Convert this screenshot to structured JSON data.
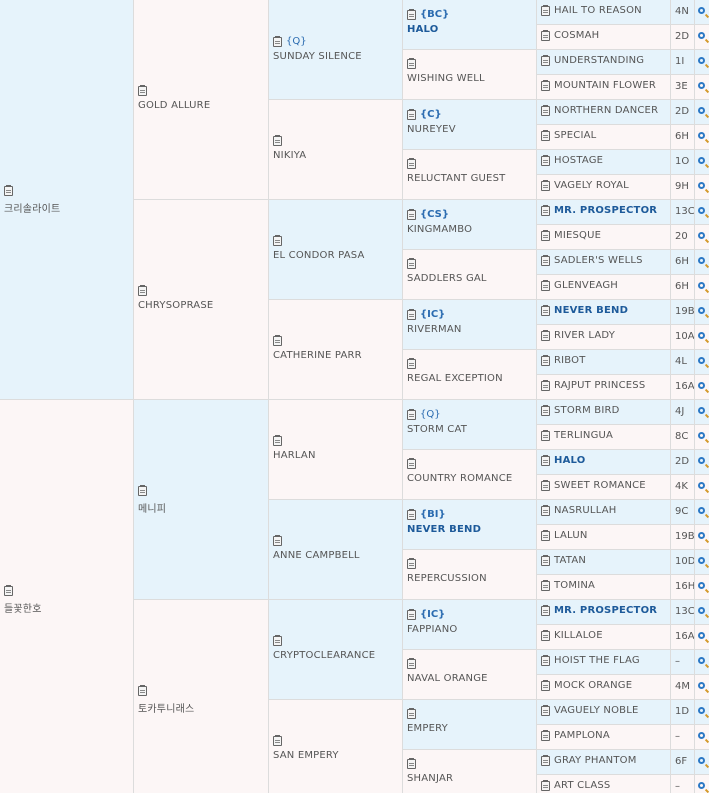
{
  "pedigree": {
    "gen1": [
      {
        "name": "크리솔라이트",
        "tag": ""
      },
      {
        "name": "들꽃한호",
        "tag": ""
      }
    ],
    "gen2": [
      {
        "name": "GOLD ALLURE",
        "tag": ""
      },
      {
        "name": "CHRYSOPRASE",
        "tag": ""
      },
      {
        "name": "메니피",
        "tag": ""
      },
      {
        "name": "토카투니래스",
        "tag": ""
      }
    ],
    "gen3": [
      {
        "name": "SUNDAY SILENCE",
        "tag": "{Q}"
      },
      {
        "name": "NIKIYA",
        "tag": ""
      },
      {
        "name": "EL CONDOR PASA",
        "tag": ""
      },
      {
        "name": "CATHERINE PARR",
        "tag": ""
      },
      {
        "name": "HARLAN",
        "tag": ""
      },
      {
        "name": "ANNE CAMPBELL",
        "tag": ""
      },
      {
        "name": "CRYPTOCLEARANCE",
        "tag": ""
      },
      {
        "name": "SAN EMPERY",
        "tag": ""
      }
    ],
    "gen4": [
      {
        "name": "HALO",
        "tag": "{BC}"
      },
      {
        "name": "WISHING WELL",
        "tag": ""
      },
      {
        "name": "NUREYEV",
        "tag": "{C}"
      },
      {
        "name": "RELUCTANT GUEST",
        "tag": ""
      },
      {
        "name": "KINGMAMBO",
        "tag": "{CS}"
      },
      {
        "name": "SADDLERS GAL",
        "tag": ""
      },
      {
        "name": "RIVERMAN",
        "tag": "{IC}"
      },
      {
        "name": "REGAL EXCEPTION",
        "tag": ""
      },
      {
        "name": "STORM CAT",
        "tag": "{Q}"
      },
      {
        "name": "COUNTRY ROMANCE",
        "tag": ""
      },
      {
        "name": "NEVER BEND",
        "tag": "{BI}"
      },
      {
        "name": "REPERCUSSION",
        "tag": ""
      },
      {
        "name": "FAPPIANO",
        "tag": "{IC}"
      },
      {
        "name": "NAVAL ORANGE",
        "tag": ""
      },
      {
        "name": "EMPERY",
        "tag": ""
      },
      {
        "name": "SHANJAR",
        "tag": ""
      }
    ],
    "gen5": [
      {
        "name": "HAIL TO REASON",
        "code": "4N"
      },
      {
        "name": "COSMAH",
        "code": "2D"
      },
      {
        "name": "UNDERSTANDING",
        "code": "1I"
      },
      {
        "name": "MOUNTAIN FLOWER",
        "code": "3E"
      },
      {
        "name": "NORTHERN DANCER",
        "code": "2D"
      },
      {
        "name": "SPECIAL",
        "code": "6H"
      },
      {
        "name": "HOSTAGE",
        "code": "1O"
      },
      {
        "name": "VAGELY ROYAL",
        "code": "9H"
      },
      {
        "name": "MR. PROSPECTOR",
        "code": "13C"
      },
      {
        "name": "MIESQUE",
        "code": "20"
      },
      {
        "name": "SADLER'S WELLS",
        "code": "6H"
      },
      {
        "name": "GLENVEAGH",
        "code": "6H"
      },
      {
        "name": "NEVER BEND",
        "code": "19B"
      },
      {
        "name": "RIVER LADY",
        "code": "10A"
      },
      {
        "name": "RIBOT",
        "code": "4L"
      },
      {
        "name": "RAJPUT PRINCESS",
        "code": "16A"
      },
      {
        "name": "STORM BIRD",
        "code": "4J"
      },
      {
        "name": "TERLINGUA",
        "code": "8C"
      },
      {
        "name": "HALO",
        "code": "2D"
      },
      {
        "name": "SWEET ROMANCE",
        "code": "4K"
      },
      {
        "name": "NASRULLAH",
        "code": "9C"
      },
      {
        "name": "LALUN",
        "code": "19B"
      },
      {
        "name": "TATAN",
        "code": "10D"
      },
      {
        "name": "TOMINA",
        "code": "16H"
      },
      {
        "name": "MR. PROSPECTOR",
        "code": "13C"
      },
      {
        "name": "KILLALOE",
        "code": "16A"
      },
      {
        "name": "HOIST THE FLAG",
        "code": "–"
      },
      {
        "name": "MOCK ORANGE",
        "code": "4M"
      },
      {
        "name": "VAGUELY NOBLE",
        "code": "1D"
      },
      {
        "name": "PAMPLONA",
        "code": "–"
      },
      {
        "name": "GRAY PHANTOM",
        "code": "6F"
      },
      {
        "name": "ART CLASS",
        "code": "–"
      }
    ]
  }
}
